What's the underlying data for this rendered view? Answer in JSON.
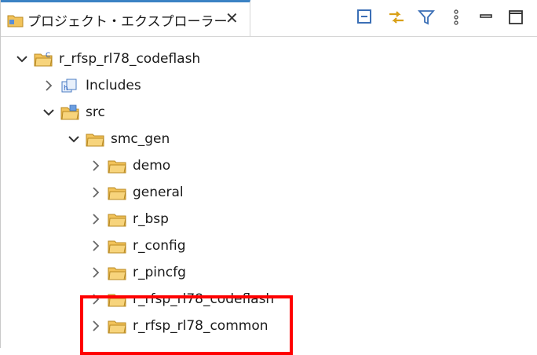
{
  "panel": {
    "title": "プロジェクト・エクスプローラー",
    "close_glyph": "✕"
  },
  "toolbar": [
    {
      "icon": "collapse-all-icon"
    },
    {
      "icon": "link-with-editor-icon"
    },
    {
      "icon": "filter-icon"
    },
    {
      "icon": "view-menu-icon"
    },
    {
      "icon": "minimize-icon"
    },
    {
      "icon": "maximize-icon"
    }
  ],
  "tree": {
    "project": {
      "label": "r_rfsp_rl78_codeflash",
      "expanded": true
    },
    "includes": {
      "label": "Includes",
      "expanded": false
    },
    "src": {
      "label": "src",
      "expanded": true
    },
    "smc_gen": {
      "label": "smc_gen",
      "expanded": true
    },
    "children": [
      {
        "label": "demo"
      },
      {
        "label": "general"
      },
      {
        "label": "r_bsp"
      },
      {
        "label": "r_config"
      },
      {
        "label": "r_pincfg"
      },
      {
        "label": "r_rfsp_rl78_codeflash"
      },
      {
        "label": "r_rfsp_rl78_common"
      }
    ]
  },
  "colors": {
    "accent": "#3b82c4",
    "highlight": "#ff0000",
    "folder": "#f2c35a"
  }
}
